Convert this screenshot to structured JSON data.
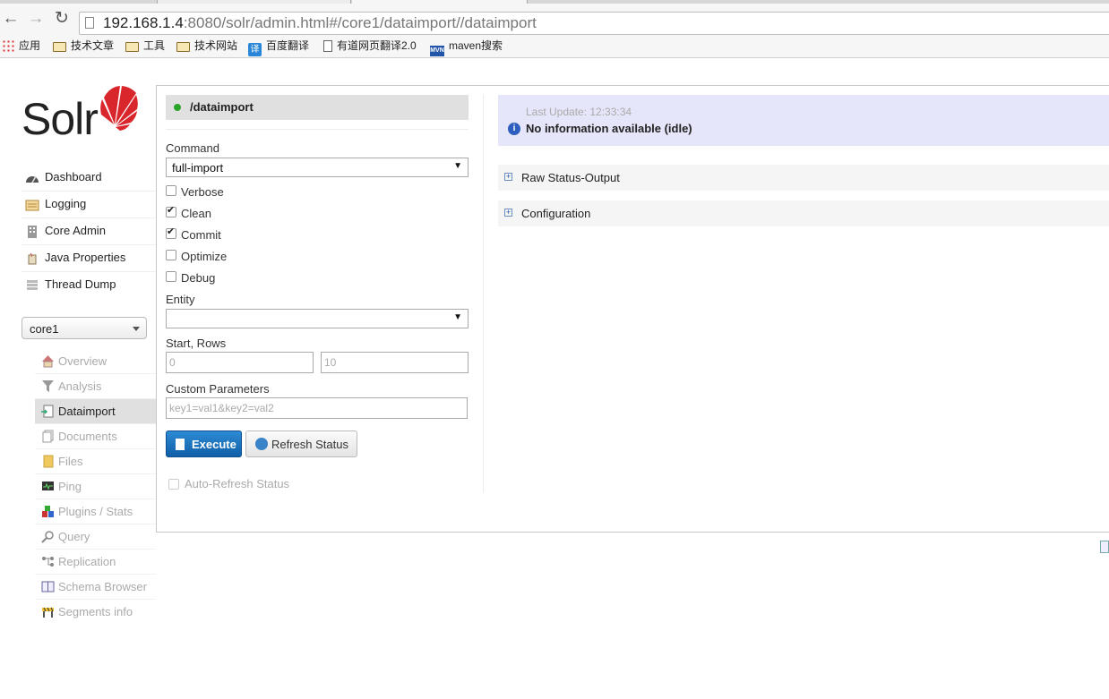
{
  "browser": {
    "url_host": "192.168.1.4",
    "url_rest": ":8080/solr/admin.html#/core1/dataimport//dataimport",
    "bookmarks": [
      {
        "label": "应用",
        "icon": "apps-grid-icon"
      },
      {
        "label": "技术文章",
        "icon": "folder-icon"
      },
      {
        "label": "工具",
        "icon": "folder-icon"
      },
      {
        "label": "技术网站",
        "icon": "folder-icon"
      },
      {
        "label": "百度翻译",
        "icon": "translate-icon"
      },
      {
        "label": "有道网页翻译2.0",
        "icon": "page-icon"
      },
      {
        "label": "maven搜索",
        "icon": "maven-icon"
      }
    ]
  },
  "logo_text": "Solr",
  "nav": {
    "main": [
      {
        "label": "Dashboard",
        "icon": "dashboard-icon"
      },
      {
        "label": "Logging",
        "icon": "logging-icon"
      },
      {
        "label": "Core Admin",
        "icon": "core-admin-icon"
      },
      {
        "label": "Java Properties",
        "icon": "java-properties-icon"
      },
      {
        "label": "Thread Dump",
        "icon": "thread-dump-icon"
      }
    ],
    "core_selector": "core1",
    "sub": [
      {
        "label": "Overview",
        "icon": "home-icon"
      },
      {
        "label": "Analysis",
        "icon": "funnel-icon"
      },
      {
        "label": "Dataimport",
        "icon": "dataimport-icon"
      },
      {
        "label": "Documents",
        "icon": "documents-icon"
      },
      {
        "label": "Files",
        "icon": "files-icon"
      },
      {
        "label": "Ping",
        "icon": "ping-icon"
      },
      {
        "label": "Plugins / Stats",
        "icon": "plugins-icon"
      },
      {
        "label": "Query",
        "icon": "query-icon"
      },
      {
        "label": "Replication",
        "icon": "replication-icon"
      },
      {
        "label": "Schema Browser",
        "icon": "schema-icon"
      },
      {
        "label": "Segments info",
        "icon": "segments-icon"
      }
    ],
    "active": "Dataimport"
  },
  "form": {
    "handler": "/dataimport",
    "command_label": "Command",
    "command_value": "full-import",
    "options": [
      {
        "label": "Verbose",
        "checked": false
      },
      {
        "label": "Clean",
        "checked": true
      },
      {
        "label": "Commit",
        "checked": true
      },
      {
        "label": "Optimize",
        "checked": false
      },
      {
        "label": "Debug",
        "checked": false
      }
    ],
    "entity_label": "Entity",
    "entity_value": "",
    "start_rows_label": "Start, Rows",
    "start_placeholder": "0",
    "rows_placeholder": "10",
    "custom_label": "Custom Parameters",
    "custom_placeholder": "key1=val1&key2=val2",
    "execute_label": "Execute",
    "refresh_label": "Refresh Status",
    "auto_refresh_label": "Auto-Refresh Status"
  },
  "status": {
    "last_update": "Last Update: 12:33:34",
    "message": "No information available (idle)",
    "sections": [
      "Raw Status-Output",
      "Configuration"
    ]
  },
  "colors": {
    "status_bg": "#e6e6fb",
    "execute_bg": "#1a73c2",
    "active_dot": "#2aa52a",
    "logo_red": "#d9262c"
  }
}
